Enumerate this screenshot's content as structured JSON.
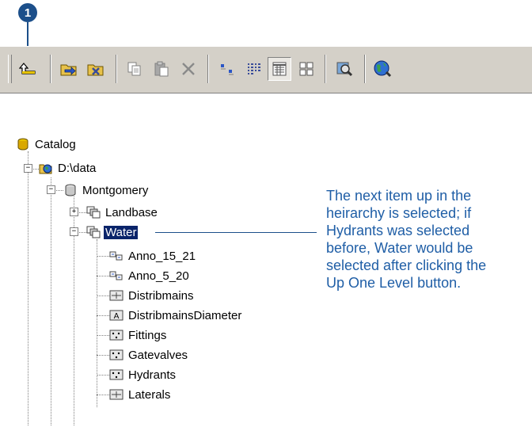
{
  "step_badge": "1",
  "toolbar": {
    "buttons": [
      {
        "name": "up-one-level-button",
        "icon": "up-one-level-icon"
      },
      {
        "name": "connect-folder-button",
        "icon": "connect-folder-icon"
      },
      {
        "name": "disconnect-folder-button",
        "icon": "disconnect-folder-icon"
      },
      {
        "name": "copy-button",
        "icon": "copy-icon"
      },
      {
        "name": "paste-button",
        "icon": "paste-icon"
      },
      {
        "name": "delete-button",
        "icon": "delete-icon"
      },
      {
        "name": "large-icons-button",
        "icon": "large-icons-icon"
      },
      {
        "name": "list-button",
        "icon": "list-icon"
      },
      {
        "name": "details-button",
        "icon": "details-icon",
        "pressed": true
      },
      {
        "name": "thumbnails-button",
        "icon": "thumbnails-icon"
      },
      {
        "name": "launch-arcmap-button",
        "icon": "magnifier-icon"
      },
      {
        "name": "globe-button",
        "icon": "globe-icon"
      }
    ]
  },
  "tree": {
    "catalog": "Catalog",
    "folder": "D:\\data",
    "database": "Montgomery",
    "dataset_landbase": "Landbase",
    "dataset_water": "Water",
    "items": [
      {
        "label": "Anno_15_21",
        "icon": "annotation-icon"
      },
      {
        "label": "Anno_5_20",
        "icon": "annotation-icon"
      },
      {
        "label": "Distribmains",
        "icon": "line-feature-class-icon"
      },
      {
        "label": "DistribmainsDiameter",
        "icon": "annotation-class-icon"
      },
      {
        "label": "Fittings",
        "icon": "point-feature-class-icon"
      },
      {
        "label": "Gatevalves",
        "icon": "point-feature-class-icon"
      },
      {
        "label": "Hydrants",
        "icon": "point-feature-class-icon"
      },
      {
        "label": "Laterals",
        "icon": "line-feature-class-icon"
      }
    ]
  },
  "annotation": {
    "lines": [
      "The next item up in the",
      "heirarchy is selected; if",
      "Hydrants was selected",
      "before, Water would be",
      "selected after clicking the",
      "Up One Level button."
    ]
  },
  "colors": {
    "accent": "#1c4f8a",
    "annotation_text": "#1f5ea6",
    "toolbar_bg": "#d4d0c8",
    "selection": "#0a246a"
  }
}
